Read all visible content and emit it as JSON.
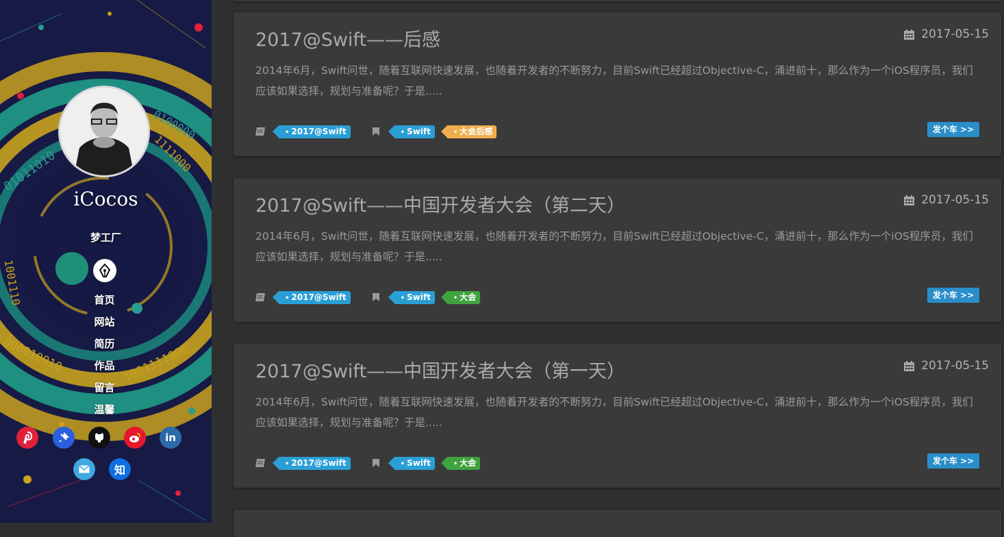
{
  "sidebar": {
    "brand_name": "iCocos",
    "tagline": "梦工厂",
    "nav": [
      {
        "label": "首页"
      },
      {
        "label": "网站"
      },
      {
        "label": "简历"
      },
      {
        "label": "作品"
      },
      {
        "label": "留言"
      },
      {
        "label": "温馨"
      }
    ],
    "social": [
      {
        "icon": "pinterest-icon",
        "glyph": "P",
        "color": "#e0213a"
      },
      {
        "icon": "pin-icon",
        "glyph": "✦",
        "color": "#2b5fe0"
      },
      {
        "icon": "github-icon",
        "glyph": "●",
        "color": "#111111"
      },
      {
        "icon": "weibo-icon",
        "glyph": "◉",
        "color": "#e6162d"
      },
      {
        "icon": "linkedin-icon",
        "glyph": "in",
        "color": "#2a6aa8"
      },
      {
        "icon": "email-icon",
        "glyph": "✉",
        "color": "#3fa9e0"
      },
      {
        "icon": "zhihu-icon",
        "glyph": "知",
        "color": "#0f6ee0"
      }
    ]
  },
  "posts": [
    {
      "title": "2017@Swift——后感",
      "date": "2017-05-15",
      "excerpt": "2014年6月，Swift问世，随着互联网快速发展，也随着开发者的不断努力，目前Swift已经超过Objective-C，涌进前十，那么作为一个iOS程序员，我们应该如果选择，规划与准备呢？于是.....",
      "category": "2017@Swift",
      "tags": [
        {
          "label": "Swift",
          "color": "#2a9fd6"
        },
        {
          "label": "大会后感",
          "color": "#f0ad4e"
        }
      ],
      "more_label": "发个车 >>"
    },
    {
      "title": "2017@Swift——中国开发者大会（第二天）",
      "date": "2017-05-15",
      "excerpt": "2014年6月，Swift问世，随着互联网快速发展，也随着开发者的不断努力，目前Swift已经超过Objective-C，涌进前十，那么作为一个iOS程序员，我们应该如果选择，规划与准备呢？于是.....",
      "category": "2017@Swift",
      "tags": [
        {
          "label": "Swift",
          "color": "#2a9fd6"
        },
        {
          "label": "大会",
          "color": "#3fa33f"
        }
      ],
      "more_label": "发个车 >>"
    },
    {
      "title": "2017@Swift——中国开发者大会（第一天）",
      "date": "2017-05-15",
      "excerpt": "2014年6月，Swift问世，随着互联网快速发展，也随着开发者的不断努力，目前Swift已经超过Objective-C，涌进前十，那么作为一个iOS程序员，我们应该如果选择，规划与准备呢？于是.....",
      "category": "2017@Swift",
      "tags": [
        {
          "label": "Swift",
          "color": "#2a9fd6"
        },
        {
          "label": "大会",
          "color": "#3fa33f"
        }
      ],
      "more_label": "发个车 >>"
    }
  ],
  "colors": {
    "category_tag": "#2a9fd6",
    "more_button": "#2a8fc9",
    "card_bg": "#3a3a3a",
    "page_bg": "#2f2f2f"
  }
}
